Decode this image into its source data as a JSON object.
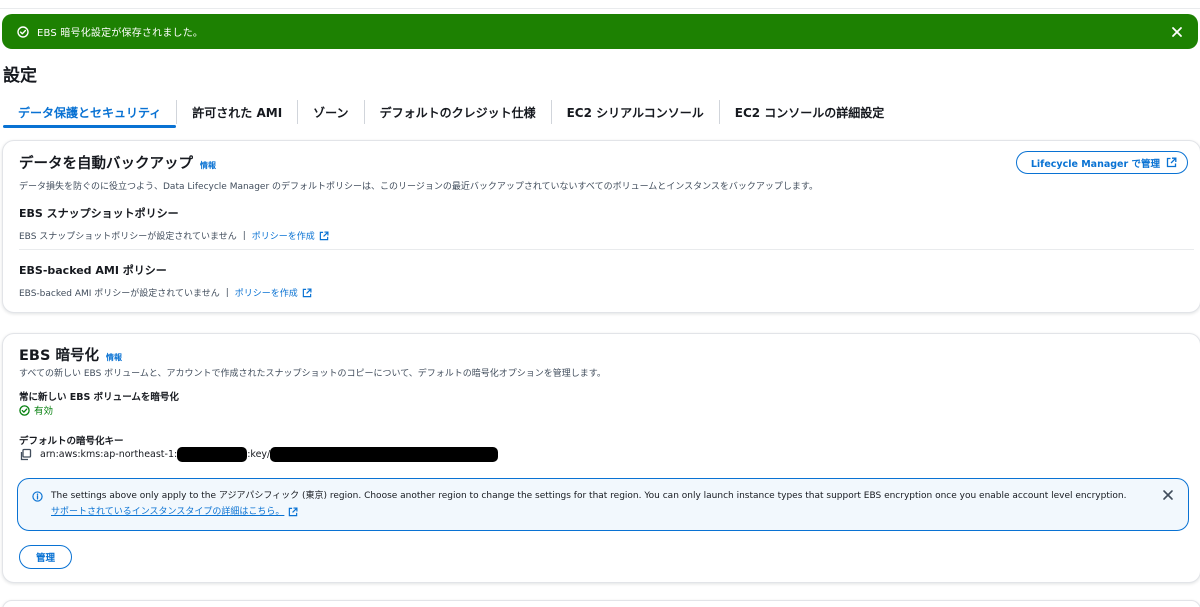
{
  "flash": {
    "message": "EBS 暗号化設定が保存されました。",
    "icon": "check-circle-icon",
    "close_icon": "close-icon",
    "color": "#1d8102"
  },
  "page": {
    "title": "設定"
  },
  "tabs": [
    {
      "label": "データ保護とセキュリティ",
      "active": true
    },
    {
      "label": "許可された AMI"
    },
    {
      "label": "ゾーン"
    },
    {
      "label": "デフォルトのクレジット仕様"
    },
    {
      "label": "EC2 シリアルコンソール"
    },
    {
      "label": "EC2 コンソールの詳細設定"
    }
  ],
  "backup": {
    "title": "データを自動バックアップ",
    "info": "情報",
    "manage_button": "Lifecycle Manager で管理",
    "description": "データ損失を防ぐのに役立つよう、Data Lifecycle Manager のデフォルトポリシーは、このリージョンの最近バックアップされていないすべてのボリュームとインスタンスをバックアップします。",
    "snapshot": {
      "heading": "EBS スナップショットポリシー",
      "status": "EBS スナップショットポリシーが設定されていません",
      "separator": "|",
      "link": "ポリシーを作成"
    },
    "ami": {
      "heading": "EBS-backed AMI ポリシー",
      "status": "EBS-backed AMI ポリシーが設定されていません",
      "separator": "|",
      "link": "ポリシーを作成"
    }
  },
  "encryption": {
    "title": "EBS 暗号化",
    "info": "情報",
    "description": "すべての新しい EBS ボリュームと、アカウントで作成されたスナップショットのコピーについて、デフォルトの暗号化オプションを管理します。",
    "always_encrypt_label": "常に新しい EBS ボリュームを暗号化",
    "always_encrypt_value": "有効",
    "default_key_label": "デフォルトの暗号化キー",
    "key_prefix": "arn:aws:kms:ap-northeast-1:",
    "key_middle": ":key/",
    "alert": {
      "text_before": "The settings above only apply to the アジアパシフィック (東京) region. Choose another region to change the settings for that region. You can only launch instance types that support EBS encryption once you enable account level encryption.",
      "link": "サポートされているインスタンスタイプの詳細はこちら。"
    },
    "manage_button": "管理"
  },
  "colors": {
    "accent": "#0972d3",
    "success": "#037f0c",
    "flash_bg": "#1d8102",
    "alert_bg": "#f2f8fd"
  }
}
